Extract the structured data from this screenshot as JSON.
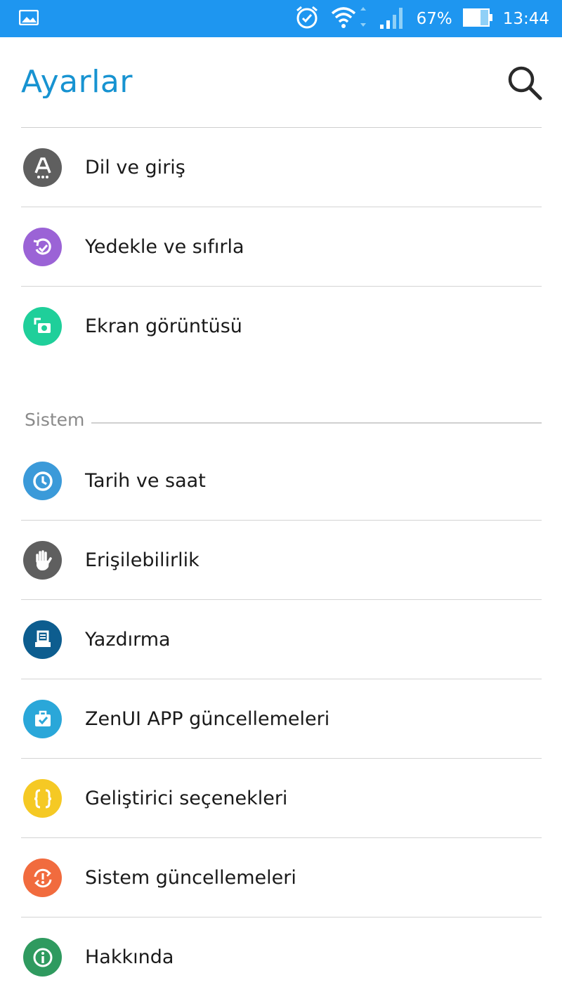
{
  "status_bar": {
    "left_icon": "image-icon",
    "battery_percent": "67%",
    "time": "13:44",
    "icons": [
      "alarm-icon",
      "wifi-icon",
      "signal-icon",
      "battery-icon"
    ],
    "background": "#1e96f0"
  },
  "header": {
    "title": "Ayarlar",
    "search_icon": "search-icon",
    "title_color": "#1793d1"
  },
  "items_top": [
    {
      "label": "Dil ve giriş",
      "icon": "language-icon",
      "color": "#5f5f5f"
    },
    {
      "label": "Yedekle ve sıfırla",
      "icon": "backup-icon",
      "color": "#9b63d6"
    },
    {
      "label": "Ekran görüntüsü",
      "icon": "screenshot-icon",
      "color": "#1fcf9a"
    }
  ],
  "section": {
    "title": "Sistem"
  },
  "items_system": [
    {
      "label": "Tarih ve saat",
      "icon": "clock-icon",
      "color": "#3b9ad9"
    },
    {
      "label": "Erişilebilirlik",
      "icon": "hand-icon",
      "color": "#5f5f5f"
    },
    {
      "label": "Yazdırma",
      "icon": "printer-icon",
      "color": "#0d5d8f"
    },
    {
      "label": "ZenUI APP güncellemeleri",
      "icon": "briefcase-check-icon",
      "color": "#2aa7d9"
    },
    {
      "label": "Geliştirici seçenekleri",
      "icon": "braces-icon",
      "color": "#f5c924"
    },
    {
      "label": "Sistem güncellemeleri",
      "icon": "system-update-icon",
      "color": "#f16b3e"
    },
    {
      "label": "Hakkında",
      "icon": "info-icon",
      "color": "#2f9a5f"
    }
  ]
}
